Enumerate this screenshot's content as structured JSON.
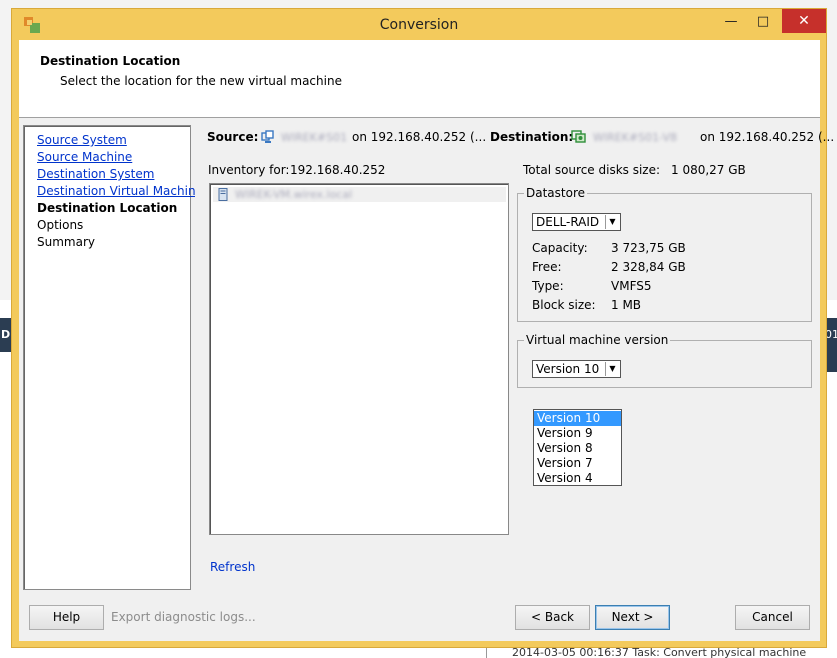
{
  "window": {
    "title": "Conversion"
  },
  "header": {
    "title": "Destination Location",
    "subtitle": "Select the location for the new virtual machine"
  },
  "nav": {
    "items": [
      {
        "label": "Source System"
      },
      {
        "label": "Source Machine"
      },
      {
        "label": "Destination System"
      },
      {
        "label": "Destination Virtual Machine"
      },
      {
        "label": "Destination Location"
      },
      {
        "label": "Options"
      },
      {
        "label": "Summary"
      }
    ]
  },
  "summary": {
    "source_label": "Source:",
    "source_name": "WIREK#S01",
    "source_host": "on 192.168.40.252 (...",
    "destination_label": "Destination:",
    "destination_name": "WIREK#S01-V8",
    "destination_host": "on 192.168.40.252 (..."
  },
  "inventory": {
    "label": "Inventory for:",
    "host": "192.168.40.252",
    "tree_item": "WIREK-VM.wirex.local",
    "refresh": "Refresh"
  },
  "disks": {
    "label": "Total source disks size:",
    "value": "1 080,27 GB"
  },
  "datastore": {
    "group_title": "Datastore",
    "selected": "DELL-RAID",
    "capacity_label": "Capacity:",
    "capacity_value": "3 723,75 GB",
    "free_label": "Free:",
    "free_value": "2 328,84 GB",
    "type_label": "Type:",
    "type_value": "VMFS5",
    "block_label": "Block size:",
    "block_value": "1 MB"
  },
  "vm_version": {
    "group_title": "Virtual machine version",
    "selected": "Version 10",
    "options": [
      "Version 10",
      "Version 9",
      "Version 8",
      "Version 7",
      "Version 4"
    ]
  },
  "footer": {
    "help": "Help",
    "export_logs": "Export diagnostic logs...",
    "back": "< Back",
    "next": "Next >",
    "cancel": "Cancel"
  },
  "background": {
    "left_header": "D",
    "right_header": "01",
    "bottom_text": "2014-03-05 00:16:37     Task: Convert physical machine"
  },
  "colors": {
    "frame": "#f3ca5c",
    "close": "#c6302b",
    "link": "#0033cc",
    "selection": "#3399ff"
  }
}
